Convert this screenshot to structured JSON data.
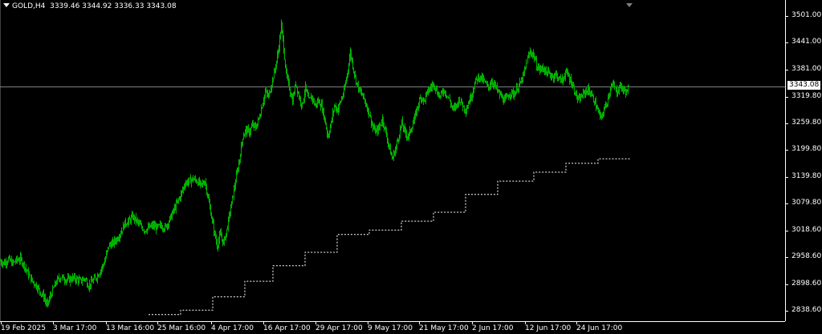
{
  "header": {
    "symbol": "GOLD,H4",
    "ohlc": "3339.46 3344.92 3336.33 3343.08"
  },
  "colors": {
    "background": "#000000",
    "candles": "#00b000",
    "axis": "#ffffff",
    "bid_line": "#808080",
    "step_line": "#ffffff"
  },
  "price_axis": {
    "labels": [
      "3501.00",
      "3441.00",
      "3381.00",
      "3319.80",
      "3259.80",
      "3199.80",
      "3139.80",
      "3079.80",
      "3018.60",
      "2958.60",
      "2898.60",
      "2838.60"
    ],
    "current_price": "3343.08"
  },
  "time_axis": {
    "labels": [
      "19 Feb 2025",
      "3 Mar 17:00",
      "13 Mar 16:00",
      "25 Mar 16:00",
      "4 Apr 17:00",
      "16 Apr 17:00",
      "29 Apr 17:00",
      "9 May 17:00",
      "21 May 17:00",
      "2 Jun 17:00",
      "12 Jun 17:00",
      "24 Jun 17:00"
    ]
  },
  "chart_data": {
    "type": "line",
    "x": [
      "19 Feb 2025",
      "3 Mar 17:00",
      "13 Mar 16:00",
      "25 Mar 16:00",
      "4 Apr 17:00",
      "16 Apr 17:00",
      "29 Apr 17:00",
      "9 May 17:00",
      "21 May 17:00",
      "2 Jun 17:00",
      "12 Jun 17:00",
      "24 Jun 17:00"
    ],
    "ylim": [
      2820,
      3525
    ],
    "series": [
      {
        "style": "candles",
        "points": [
          [
            0,
            2950
          ],
          [
            5,
            2946
          ],
          [
            10,
            2955
          ],
          [
            15,
            2945
          ],
          [
            20,
            2952
          ],
          [
            25,
            2955
          ],
          [
            30,
            2940
          ],
          [
            35,
            2920
          ],
          [
            40,
            2905
          ],
          [
            45,
            2895
          ],
          [
            50,
            2880
          ],
          [
            55,
            2868
          ],
          [
            58,
            2850
          ],
          [
            62,
            2870
          ],
          [
            66,
            2888
          ],
          [
            70,
            2905
          ],
          [
            75,
            2915
          ],
          [
            80,
            2910
          ],
          [
            85,
            2908
          ],
          [
            90,
            2912
          ],
          [
            95,
            2910
          ],
          [
            100,
            2905
          ],
          [
            105,
            2912
          ],
          [
            110,
            2895
          ],
          [
            115,
            2905
          ],
          [
            120,
            2915
          ],
          [
            125,
            2930
          ],
          [
            130,
            2950
          ],
          [
            135,
            2985
          ],
          [
            140,
            2990
          ],
          [
            145,
            3000
          ],
          [
            150,
            3015
          ],
          [
            155,
            3035
          ],
          [
            160,
            3040
          ],
          [
            165,
            3050
          ],
          [
            170,
            3040
          ],
          [
            175,
            3028
          ],
          [
            180,
            3020
          ],
          [
            185,
            3025
          ],
          [
            190,
            3030
          ],
          [
            195,
            3025
          ],
          [
            200,
            3030
          ],
          [
            205,
            3025
          ],
          [
            210,
            3040
          ],
          [
            215,
            3060
          ],
          [
            220,
            3080
          ],
          [
            225,
            3100
          ],
          [
            230,
            3125
          ],
          [
            235,
            3130
          ],
          [
            240,
            3135
          ],
          [
            245,
            3130
          ],
          [
            250,
            3120
          ],
          [
            255,
            3130
          ],
          [
            258,
            3100
          ],
          [
            262,
            3060
          ],
          [
            266,
            3020
          ],
          [
            270,
            2985
          ],
          [
            274,
            3010
          ],
          [
            278,
            2990
          ],
          [
            282,
            3020
          ],
          [
            286,
            3060
          ],
          [
            290,
            3100
          ],
          [
            294,
            3140
          ],
          [
            298,
            3180
          ],
          [
            302,
            3230
          ],
          [
            306,
            3245
          ],
          [
            310,
            3240
          ],
          [
            314,
            3255
          ],
          [
            318,
            3250
          ],
          [
            322,
            3270
          ],
          [
            326,
            3300
          ],
          [
            330,
            3330
          ],
          [
            334,
            3320
          ],
          [
            338,
            3350
          ],
          [
            342,
            3380
          ],
          [
            346,
            3420
          ],
          [
            350,
            3480
          ],
          [
            353,
            3430
          ],
          [
            356,
            3370
          ],
          [
            360,
            3340
          ],
          [
            364,
            3310
          ],
          [
            368,
            3350
          ],
          [
            372,
            3320
          ],
          [
            376,
            3300
          ],
          [
            380,
            3340
          ],
          [
            384,
            3310
          ],
          [
            388,
            3320
          ],
          [
            392,
            3300
          ],
          [
            396,
            3310
          ],
          [
            400,
            3300
          ],
          [
            404,
            3270
          ],
          [
            408,
            3230
          ],
          [
            412,
            3260
          ],
          [
            416,
            3300
          ],
          [
            420,
            3290
          ],
          [
            424,
            3310
          ],
          [
            428,
            3330
          ],
          [
            432,
            3370
          ],
          [
            436,
            3420
          ],
          [
            440,
            3380
          ],
          [
            444,
            3350
          ],
          [
            448,
            3330
          ],
          [
            452,
            3320
          ],
          [
            456,
            3300
          ],
          [
            460,
            3280
          ],
          [
            464,
            3250
          ],
          [
            468,
            3240
          ],
          [
            472,
            3250
          ],
          [
            476,
            3270
          ],
          [
            480,
            3240
          ],
          [
            484,
            3210
          ],
          [
            488,
            3180
          ],
          [
            492,
            3200
          ],
          [
            496,
            3230
          ],
          [
            500,
            3260
          ],
          [
            504,
            3240
          ],
          [
            508,
            3230
          ],
          [
            512,
            3250
          ],
          [
            516,
            3270
          ],
          [
            520,
            3300
          ],
          [
            524,
            3320
          ],
          [
            528,
            3310
          ],
          [
            532,
            3330
          ],
          [
            536,
            3340
          ],
          [
            540,
            3350
          ],
          [
            544,
            3330
          ],
          [
            548,
            3320
          ],
          [
            552,
            3335
          ],
          [
            556,
            3325
          ],
          [
            560,
            3310
          ],
          [
            564,
            3290
          ],
          [
            568,
            3300
          ],
          [
            572,
            3315
          ],
          [
            576,
            3300
          ],
          [
            580,
            3290
          ],
          [
            584,
            3310
          ],
          [
            588,
            3330
          ],
          [
            592,
            3355
          ],
          [
            596,
            3365
          ],
          [
            600,
            3360
          ],
          [
            604,
            3350
          ],
          [
            608,
            3340
          ],
          [
            612,
            3355
          ],
          [
            616,
            3345
          ],
          [
            620,
            3330
          ],
          [
            624,
            3320
          ],
          [
            628,
            3310
          ],
          [
            632,
            3320
          ],
          [
            636,
            3330
          ],
          [
            640,
            3325
          ],
          [
            644,
            3340
          ],
          [
            648,
            3350
          ],
          [
            652,
            3370
          ],
          [
            656,
            3400
          ],
          [
            660,
            3420
          ],
          [
            664,
            3415
          ],
          [
            668,
            3390
          ],
          [
            672,
            3380
          ],
          [
            676,
            3385
          ],
          [
            680,
            3375
          ],
          [
            684,
            3370
          ],
          [
            688,
            3365
          ],
          [
            692,
            3370
          ],
          [
            696,
            3360
          ],
          [
            700,
            3355
          ],
          [
            704,
            3375
          ],
          [
            708,
            3365
          ],
          [
            712,
            3350
          ],
          [
            716,
            3330
          ],
          [
            720,
            3310
          ],
          [
            724,
            3320
          ],
          [
            728,
            3330
          ],
          [
            732,
            3335
          ],
          [
            736,
            3325
          ],
          [
            740,
            3310
          ],
          [
            744,
            3290
          ],
          [
            748,
            3270
          ],
          [
            752,
            3290
          ],
          [
            756,
            3310
          ],
          [
            760,
            3340
          ],
          [
            764,
            3345
          ],
          [
            768,
            3330
          ],
          [
            772,
            3345
          ],
          [
            776,
            3335
          ],
          [
            780,
            3330
          ],
          [
            784,
            3343
          ]
        ]
      },
      {
        "style": "dotted-steps",
        "points": [
          [
            185,
            2830
          ],
          [
            225,
            2830
          ],
          [
            225,
            2840
          ],
          [
            265,
            2840
          ],
          [
            265,
            2870
          ],
          [
            305,
            2870
          ],
          [
            305,
            2905
          ],
          [
            340,
            2905
          ],
          [
            340,
            2940
          ],
          [
            380,
            2940
          ],
          [
            380,
            2970
          ],
          [
            420,
            2970
          ],
          [
            420,
            3010
          ],
          [
            460,
            3010
          ],
          [
            460,
            3020
          ],
          [
            500,
            3020
          ],
          [
            500,
            3040
          ],
          [
            540,
            3040
          ],
          [
            540,
            3060
          ],
          [
            580,
            3060
          ],
          [
            580,
            3100
          ],
          [
            620,
            3100
          ],
          [
            620,
            3130
          ],
          [
            665,
            3130
          ],
          [
            665,
            3150
          ],
          [
            705,
            3150
          ],
          [
            705,
            3170
          ],
          [
            745,
            3170
          ],
          [
            745,
            3180
          ],
          [
            785,
            3180
          ]
        ]
      }
    ],
    "current_price": 3343.08
  }
}
